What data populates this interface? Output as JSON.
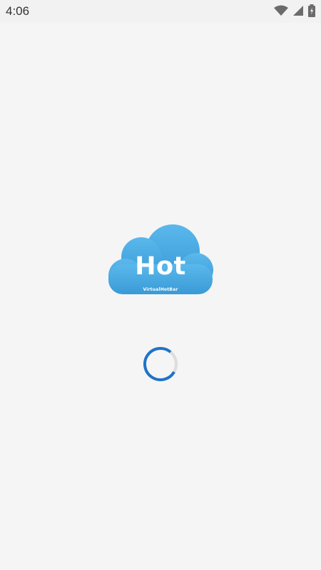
{
  "status_bar": {
    "time": "4:06",
    "icons": [
      "wifi-icon",
      "cellular-signal-icon",
      "battery-charging-icon"
    ]
  },
  "splash": {
    "logo_title": "Hot",
    "logo_subtitle": "VirtualHotBar",
    "logo_color": "#4aaee6"
  },
  "loading": {
    "indicator": "spinner",
    "accent_color": "#1e73c8"
  }
}
